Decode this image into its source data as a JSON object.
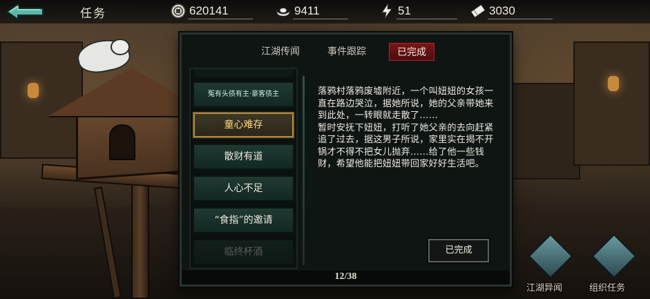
{
  "header": {
    "title": "任务",
    "back_icon": "back-arrow-icon"
  },
  "resources": [
    {
      "name": "coin",
      "icon": "coin-icon",
      "value": "620141"
    },
    {
      "name": "silver",
      "icon": "silver-ingot-icon",
      "value": "9411"
    },
    {
      "name": "energy",
      "icon": "lightning-icon",
      "value": "51"
    },
    {
      "name": "ticket",
      "icon": "ticket-icon",
      "value": "3030"
    }
  ],
  "tabs": [
    {
      "label": "江湖传闻",
      "active": false
    },
    {
      "label": "事件跟踪",
      "active": false
    },
    {
      "label": "已完成",
      "active": true
    }
  ],
  "quest_list": [
    {
      "label": "冤有头债有主·豪客债主",
      "state": "normal"
    },
    {
      "label": "童心难存",
      "state": "selected"
    },
    {
      "label": "散财有道",
      "state": "normal"
    },
    {
      "label": "人心不足",
      "state": "normal"
    },
    {
      "label": "“食指”的邀请",
      "state": "normal"
    },
    {
      "label": "临终杯酒",
      "state": "faded"
    }
  ],
  "description": "落鸦村落鸦废墟附近，一个叫妞妞的女孩一直在路边哭泣，据她所说，她的父亲带她来到此处，一转眼就走散了……\n暂时安抚下妞妞，打听了她父亲的去向赶紧追了过去，据这男子所说，家里实在揭不开锅才不得不把女儿抛弃……给了他一些钱财，希望他能把妞妞带回家好好生活吧。",
  "status_button": "已完成",
  "pagination": "12/38",
  "bottom_labels": [
    "江湖异闻",
    "组织任务"
  ],
  "colors": {
    "active_tab": "#7a1518",
    "selected_item_text": "#ffd680",
    "list_item": "#1f3a33"
  }
}
